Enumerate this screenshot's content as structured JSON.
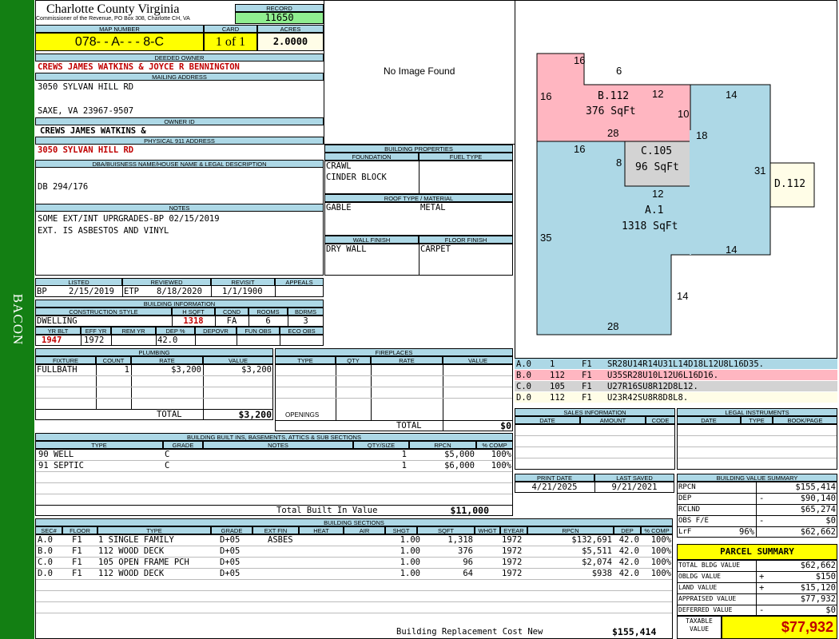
{
  "side_label": "BACON",
  "header": {
    "county": "Charlotte County Virginia",
    "commissioner": "Commissioner of the Revenue, PO Box 308, Charlotte CH, VA",
    "record_label": "RECORD",
    "record": "11650",
    "map_label": "MAP NUMBER",
    "map_number": "078- - A- - - 8-C",
    "card_label": "CARD",
    "card": "1 of 1",
    "acres_label": "ACRES",
    "acres": "2.0000"
  },
  "owner": {
    "deeded_label": "DEEDED OWNER",
    "deeded": "CREWS JAMES WATKINS & JOYCE R BENNINGTON",
    "mailing_label": "MAILING ADDRESS",
    "mail1": "3050 SYLVAN HILL RD",
    "mail2": "SAXE, VA 23967-9507",
    "owner_id_label": "OWNER ID",
    "owner_id": "CREWS JAMES WATKINS &",
    "physical_label": "PHYSICAL 911 ADDRESS",
    "physical": "3050 SYLVAN HILL RD",
    "dba_label": "DBA/BUISNESS NAME/HOUSE NAME & LEGAL DESCRIPTION",
    "dba": "DB 294/176",
    "notes_label": "NOTES",
    "note1": "SOME EXT/INT UPRGRADES-BP 02/15/2019",
    "note2": "EXT. IS ASBESTOS AND VINYL"
  },
  "image": {
    "no_image": "No Image Found"
  },
  "bprops": {
    "title": "BUILDING PROPERTIES",
    "foundation_label": "FOUNDATION",
    "fuel_label": "FUEL TYPE",
    "found1": "CRAWL",
    "found2": "CINDER BLOCK",
    "roof_label": "ROOF TYPE / MATERIAL",
    "roof_type": "GABLE",
    "roof_mat": "METAL",
    "wall_label": "WALL FINISH",
    "floor_label": "FLOOR FINISH",
    "wall": "DRY WALL",
    "floor": "CARPET"
  },
  "dates": {
    "listed_label": "LISTED",
    "reviewed_label": "REVIEWED",
    "revisit_label": "REVISIT",
    "appeals_label": "APPEALS",
    "listed_by": "BP",
    "listed": "2/15/2019",
    "reviewed_by": "ETP",
    "reviewed": "8/18/2020",
    "revisit": "1/1/1900"
  },
  "binfo": {
    "title": "BUILDING INFORMATION",
    "style_label": "CONSTRUCTION STYLE",
    "hsqft_label": "H SQFT",
    "cond_label": "COND",
    "rooms_label": "ROOMS",
    "bdrms_label": "BDRMS",
    "style": "DWELLING",
    "hsqft": "1318",
    "cond": "FA",
    "rooms": "6",
    "bdrms": "3",
    "yrblt_label": "YR BLT",
    "effyr_label": "EFF YR",
    "remyr_label": "REM YR",
    "dep_label": "DEP %",
    "depovr_label": "DEPOVR",
    "funobs_label": "FUN OBS",
    "ecoobs_label": "ECO OBS",
    "yrblt": "1947",
    "effyr": "1972",
    "dep": "42.0"
  },
  "plumbing": {
    "title": "PLUMBING",
    "fixture_label": "FIXTURE",
    "count_label": "COUNT",
    "rate_label": "RATE",
    "value_label": "VALUE",
    "fixture": "FULLBATH",
    "count": "1",
    "rate": "$3,200",
    "value": "$3,200",
    "total_label": "TOTAL",
    "total": "$3,200"
  },
  "fireplaces": {
    "title": "FIREPLACES",
    "type_label": "TYPE",
    "qty_label": "QTY",
    "rate_label": "RATE",
    "value_label": "VALUE",
    "openings_label": "OPENINGS",
    "total_label": "TOTAL",
    "total": "$0"
  },
  "builtins": {
    "title": "BUILDING BUILT INS, BASEMENTS, ATTICS & SUB SECTIONS",
    "type_label": "TYPE",
    "grade_label": "GRADE",
    "notes_label": "NOTES",
    "qty_label": "QTY/SIZE",
    "rpcn_label": "RPCN",
    "comp_label": "% COMP",
    "rows": [
      {
        "type": "90 WELL",
        "grade": "C",
        "qty": "1",
        "rpcn": "$5,000",
        "comp": "100%"
      },
      {
        "type": "91 SEPTIC",
        "grade": "C",
        "qty": "1",
        "rpcn": "$6,000",
        "comp": "100%"
      }
    ],
    "total_label": "Total Built In Value",
    "total": "$11,000"
  },
  "sections": {
    "title": "BUILDING SECTIONS",
    "sec_label": "SEC#",
    "floor_label": "FLOOR",
    "type_label": "TYPE",
    "grade_label": "GRADE",
    "extfin_label": "EXT FIN",
    "heat_label": "HEAT",
    "air_label": "AIR",
    "shgt_label": "SHGT",
    "sqft_label": "SQFT",
    "whgt_label": "WHGT",
    "eyear_label": "EYEAR",
    "rpcn_label": "RPCN",
    "dep_label": "DEP",
    "comp_label": "% COMP",
    "rows": [
      {
        "sec": "A.0",
        "floor": "F1",
        "type": "1 SINGLE FAMILY",
        "grade": "D+05",
        "extfin": "ASBES",
        "shgt": "1.00",
        "sqft": "1,318",
        "eyear": "1972",
        "rpcn": "$132,691",
        "dep": "42.0",
        "comp": "100%"
      },
      {
        "sec": "B.0",
        "floor": "F1",
        "type": "112 WOOD DECK",
        "grade": "D+05",
        "extfin": "",
        "shgt": "1.00",
        "sqft": "376",
        "eyear": "1972",
        "rpcn": "$5,511",
        "dep": "42.0",
        "comp": "100%"
      },
      {
        "sec": "C.0",
        "floor": "F1",
        "type": "105 OPEN FRAME PCH",
        "grade": "D+05",
        "extfin": "",
        "shgt": "1.00",
        "sqft": "96",
        "eyear": "1972",
        "rpcn": "$2,074",
        "dep": "42.0",
        "comp": "100%"
      },
      {
        "sec": "D.0",
        "floor": "F1",
        "type": "112 WOOD DECK",
        "grade": "D+05",
        "extfin": "",
        "shgt": "1.00",
        "sqft": "64",
        "eyear": "1972",
        "rpcn": "$938",
        "dep": "42.0",
        "comp": "100%"
      }
    ],
    "brcn_label": "Building Replacement Cost New",
    "brcn": "$155,414"
  },
  "sketch": {
    "labels": {
      "b_name": "B.112",
      "b_area": "376 SqFt",
      "c_name": "C.105",
      "c_area": "96 SqFt",
      "a_name": "A.1",
      "a_area": "1318 SqFt",
      "d_name": "D.112"
    },
    "dims": {
      "b_top": "16",
      "b_notch": "6",
      "b_left": "16",
      "b_right_top": "12",
      "b_right": "10",
      "b_bottom": "28",
      "a_right_top": "14",
      "a_step": "18",
      "c_top": "16",
      "c_left": "8",
      "c_bottom": "12",
      "a_right": "31",
      "a_left": "35",
      "a_step2": "14",
      "a_right_low": "14",
      "a_bottom": "28"
    },
    "colors": {
      "a": "#add8e6",
      "b": "#ffb6c1",
      "c": "#d3d3d3",
      "d": "#fffde7"
    }
  },
  "legend": [
    {
      "sec": "A.0",
      "code": "1",
      "floor": "F1",
      "path": "SR28U14R14U31L14D18L12U8L16D35.",
      "color": "#add8e6"
    },
    {
      "sec": "B.0",
      "code": "112",
      "floor": "F1",
      "path": "U35SR28U10L12U6L16D16.",
      "color": "#ffb6c1"
    },
    {
      "sec": "C.0",
      "code": "105",
      "floor": "F1",
      "path": "U27R16SU8R12D8L12.",
      "color": "#d3d3d3"
    },
    {
      "sec": "D.0",
      "code": "112",
      "floor": "F1",
      "path": "U23R42SU8R8D8L8.",
      "color": "#fffde7"
    }
  ],
  "sales": {
    "title": "SALES INFORMATION",
    "date_label": "DATE",
    "amount_label": "AMOUNT",
    "code_label": "CODE"
  },
  "legal": {
    "title": "LEGAL INSTRUMENTS",
    "date_label": "DATE",
    "type_label": "TYPE",
    "book_label": "BOOK/PAGE"
  },
  "print": {
    "print_label": "PRINT DATE",
    "saved_label": "LAST SAVED",
    "print_date": "4/21/2025",
    "saved": "9/21/2021"
  },
  "bvs": {
    "title": "BUILDING VALUE SUMMARY",
    "rpcn_label": "RPCN",
    "rpcn": "$155,414",
    "dep_label": "DEP",
    "dep_sign": "-",
    "dep": "$90,140",
    "rclnd_label": "RCLND",
    "rclnd": "$65,274",
    "obs_label": "OBS F/E",
    "obs_sign": "-",
    "obs": "$0",
    "lrf_label": "LrF",
    "lrf_pct": "96%",
    "lrf": "$62,662"
  },
  "parcel": {
    "title": "PARCEL SUMMARY",
    "tbv_label": "TOTAL BLDG VALUE",
    "tbv": "$62,662",
    "obldg_label": "OBLDG VALUE",
    "obldg_sign": "+",
    "obldg": "$150",
    "land_label": "LAND VALUE",
    "land_sign": "+",
    "land": "$15,120",
    "appr_label": "APPRAISED VALUE",
    "appr": "$77,932",
    "def_label": "DEFERRED VALUE",
    "def_sign": "-",
    "def": "$0",
    "taxable_label1": "TAXABLE",
    "taxable_label2": "VALUE",
    "taxable": "$77,932"
  }
}
